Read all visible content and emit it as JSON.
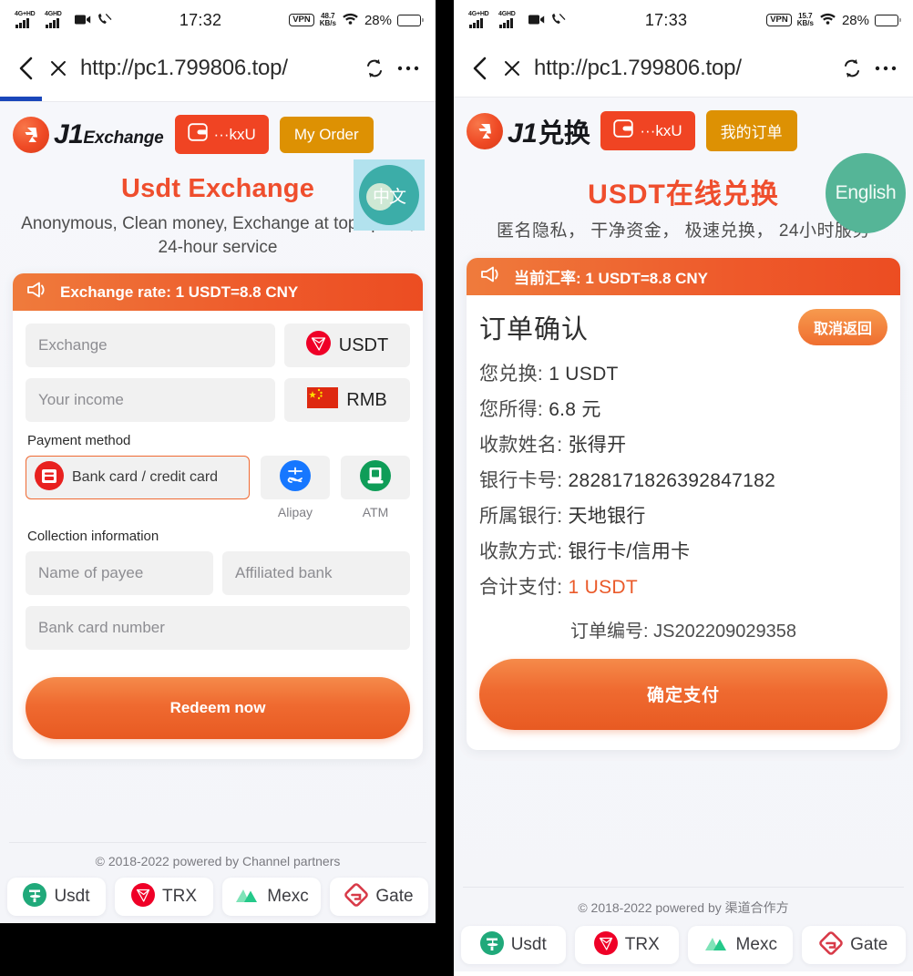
{
  "left_panel": {
    "statusbar": {
      "network_1": "4G+HD",
      "network_2": "4GHD",
      "time": "17:32",
      "vpn": "VPN",
      "speed_value": "48.7",
      "speed_unit": "KB/s",
      "battery_percent": "28%"
    },
    "browser": {
      "url": "http://pc1.799806.top/"
    },
    "brand": {
      "logo_j1": "J1",
      "logo_suffix": "Exchange"
    },
    "wallet_button": "···kxU",
    "order_button": "My Order",
    "hero": {
      "title": "Usdt Exchange",
      "subtitle": "Anonymous, Clean money, Exchange at top speed, 24-hour service",
      "lang_toggle": "中文"
    },
    "card": {
      "rate_banner": "Exchange rate: 1 USDT=8.8 CNY",
      "exchange_placeholder": "Exchange",
      "exchange_coin": "USDT",
      "income_placeholder": "Your income",
      "income_coin": "RMB",
      "payment_method_label": "Payment method",
      "payment_selected": "Bank card / credit card",
      "payment_options": [
        {
          "name": "Alipay",
          "icon": "alipay-icon"
        },
        {
          "name": "ATM",
          "icon": "atm-icon"
        }
      ],
      "collection_label": "Collection information",
      "payee_placeholder": "Name of payee",
      "bank_placeholder": "Affiliated bank",
      "card_number_placeholder": "Bank card number",
      "submit_button": "Redeem now"
    },
    "footer": {
      "copyright": "© 2018-2022 powered by Channel partners",
      "partners": [
        {
          "name": "Usdt",
          "icon": "usdt-icon",
          "color": "#20a97a"
        },
        {
          "name": "TRX",
          "icon": "trx-icon",
          "color": "#ef0027"
        },
        {
          "name": "Mexc",
          "icon": "mexc-icon",
          "color": "#3ecf8e"
        },
        {
          "name": "Gate",
          "icon": "gate-icon",
          "color": "#d83a48"
        }
      ]
    }
  },
  "right_panel": {
    "statusbar": {
      "network_1": "4G+HD",
      "network_2": "4GHD",
      "time": "17:33",
      "vpn": "VPN",
      "speed_value": "15.7",
      "speed_unit": "KB/s",
      "battery_percent": "28%"
    },
    "browser": {
      "url": "http://pc1.799806.top/"
    },
    "brand": {
      "logo_j1": "J1",
      "logo_suffix": "兑换"
    },
    "wallet_button": "···kxU",
    "order_button": "我的订单",
    "hero": {
      "title": "USDT在线兑换",
      "subtitle": "匿名隐私， 干净资金， 极速兑换， 24小时服务",
      "lang_toggle": "English"
    },
    "card": {
      "rate_banner": "当前汇率: 1 USDT=8.8 CNY",
      "title": "订单确认",
      "cancel_button": "取消返回",
      "details": [
        {
          "key": "您兑换:",
          "value": "1 USDT",
          "accent": false
        },
        {
          "key": "您所得:",
          "value": "6.8 元",
          "accent": false
        },
        {
          "key": "收款姓名:",
          "value": "张得开",
          "accent": false
        },
        {
          "key": "银行卡号:",
          "value": "2828171826392847182",
          "accent": false
        },
        {
          "key": "所属银行:",
          "value": "天地银行",
          "accent": false
        },
        {
          "key": "收款方式:",
          "value": "银行卡/信用卡",
          "accent": false
        },
        {
          "key": "合计支付:",
          "value": "1 USDT",
          "accent": true
        }
      ],
      "order_no_label": "订单编号:",
      "order_no_value": "JS202209029358",
      "submit_button": "确定支付"
    },
    "footer": {
      "copyright": "© 2018-2022 powered by 渠道合作方",
      "partners": [
        {
          "name": "Usdt",
          "icon": "usdt-icon",
          "color": "#20a97a"
        },
        {
          "name": "TRX",
          "icon": "trx-icon",
          "color": "#ef0027"
        },
        {
          "name": "Mexc",
          "icon": "mexc-icon",
          "color": "#3ecf8e"
        },
        {
          "name": "Gate",
          "icon": "gate-icon",
          "color": "#d83a48"
        }
      ]
    }
  },
  "colors": {
    "accent_orange": "#ef4e2d",
    "banner_orange": "#ee5a2b",
    "order_gold": "#dd9103",
    "wallet_red": "#f04423",
    "progress_blue": "#1a46ba"
  }
}
